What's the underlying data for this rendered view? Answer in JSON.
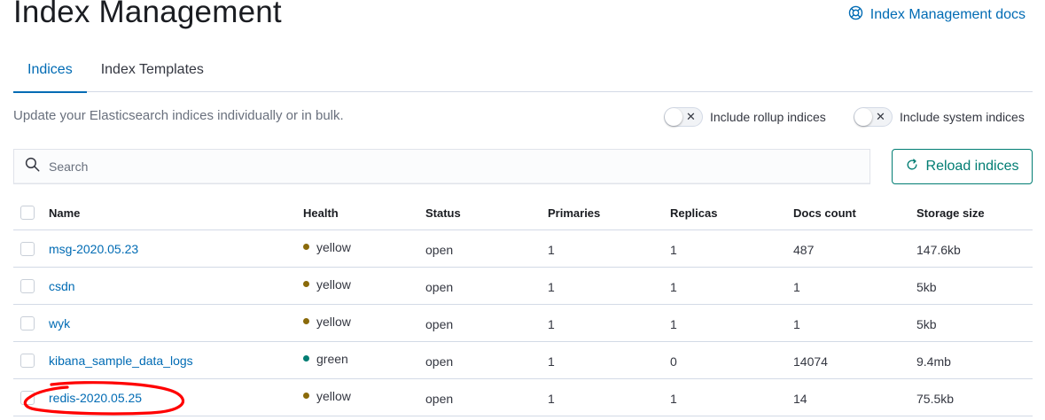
{
  "page": {
    "title": "Index Management",
    "docs_link": "Index Management docs"
  },
  "tabs": [
    {
      "label": "Indices",
      "active": true
    },
    {
      "label": "Index Templates",
      "active": false
    }
  ],
  "description": "Update your Elasticsearch indices individually or in bulk.",
  "toggles": {
    "rollup": {
      "label": "Include rollup indices",
      "checked": false
    },
    "system": {
      "label": "Include system indices",
      "checked": false
    }
  },
  "search": {
    "placeholder": "Search",
    "value": ""
  },
  "reload_button": {
    "label": "Reload indices"
  },
  "colors": {
    "link": "#006bb4",
    "reload": "#017d73",
    "health_yellow": "#8a6a0a",
    "health_green": "#017d73",
    "annotation": "#ff0000"
  },
  "table": {
    "headers": {
      "name": "Name",
      "health": "Health",
      "status": "Status",
      "primaries": "Primaries",
      "replicas": "Replicas",
      "docs_count": "Docs count",
      "storage_size": "Storage size"
    },
    "rows": [
      {
        "name": "msg-2020.05.23",
        "health": "yellow",
        "status": "open",
        "primaries": "1",
        "replicas": "1",
        "docs_count": "487",
        "storage_size": "147.6kb"
      },
      {
        "name": "csdn",
        "health": "yellow",
        "status": "open",
        "primaries": "1",
        "replicas": "1",
        "docs_count": "1",
        "storage_size": "5kb"
      },
      {
        "name": "wyk",
        "health": "yellow",
        "status": "open",
        "primaries": "1",
        "replicas": "1",
        "docs_count": "1",
        "storage_size": "5kb"
      },
      {
        "name": "kibana_sample_data_logs",
        "health": "green",
        "status": "open",
        "primaries": "1",
        "replicas": "0",
        "docs_count": "14074",
        "storage_size": "9.4mb"
      },
      {
        "name": "redis-2020.05.25",
        "health": "yellow",
        "status": "open",
        "primaries": "1",
        "replicas": "1",
        "docs_count": "14",
        "storage_size": "75.5kb"
      }
    ]
  }
}
